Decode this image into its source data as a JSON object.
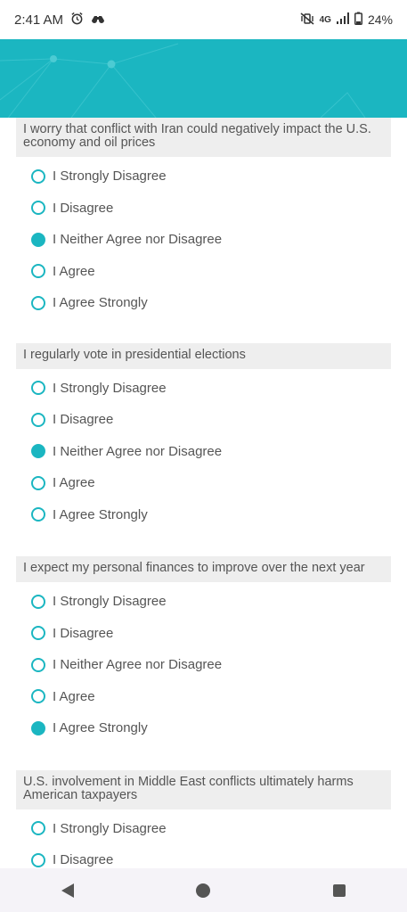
{
  "status_bar": {
    "time": "2:41 AM",
    "alarm_icon": "alarm-clock-icon",
    "app_icon": "binoculars-icon",
    "network_label": "4G",
    "battery": "24%"
  },
  "colors": {
    "accent": "#1bb6c1",
    "question_bg": "#eeeeee"
  },
  "questions": [
    {
      "text": "I worry that conflict with Iran could negatively impact the U.S. economy and oil prices",
      "options": [
        "I Strongly Disagree",
        "I Disagree",
        "I Neither Agree nor Disagree",
        "I Agree",
        "I Agree Strongly"
      ],
      "selected": "I Neither Agree nor Disagree"
    },
    {
      "text": "I regularly vote in presidential elections",
      "options": [
        "I Strongly Disagree",
        "I Disagree",
        "I Neither Agree nor Disagree",
        "I Agree",
        "I Agree Strongly"
      ],
      "selected": "I Neither Agree nor Disagree"
    },
    {
      "text": "I expect my personal finances to improve over the next year",
      "options": [
        "I Strongly Disagree",
        "I Disagree",
        "I Neither Agree nor Disagree",
        "I Agree",
        "I Agree Strongly"
      ],
      "selected": "I Agree Strongly"
    },
    {
      "text": "U.S. involvement in Middle East conflicts ultimately harms American taxpayers",
      "options": [
        "I Strongly Disagree",
        "I Disagree"
      ],
      "selected": null
    }
  ],
  "nav": {
    "back_icon": "back-triangle-icon",
    "home_icon": "home-circle-icon",
    "recents_icon": "recents-square-icon"
  }
}
